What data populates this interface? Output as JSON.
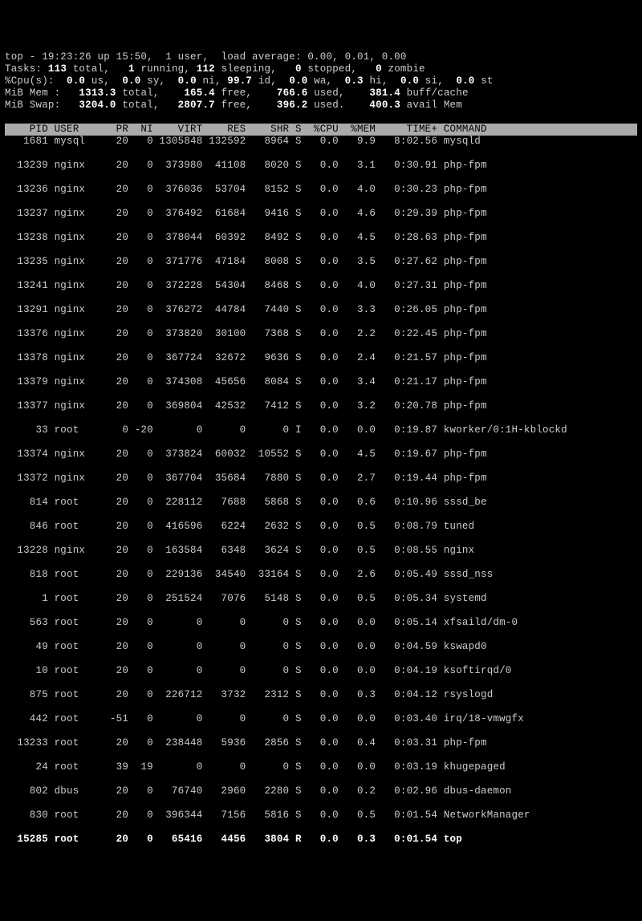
{
  "summary": {
    "line1_pre": "top - 19:23:26 up 15:50,  1 user,  load average: 0.00, 0.01, 0.00",
    "tasks": {
      "total": "113",
      "running": "1",
      "sleeping": "112",
      "stopped": "0",
      "zombie": "0"
    },
    "cpu": {
      "us": "0.0",
      "sy": "0.0",
      "ni": "0.0",
      "id": "99.7",
      "wa": "0.0",
      "hi": "0.3",
      "si": "0.0",
      "st": "0.0"
    },
    "mem": {
      "total": "1313.3",
      "free": "165.4",
      "used": "766.6",
      "buff": "381.4"
    },
    "swap": {
      "total": "3204.0",
      "free": "2807.7",
      "used": "396.2",
      "avail": "400.3"
    }
  },
  "columns": [
    "PID",
    "USER",
    "PR",
    "NI",
    "VIRT",
    "RES",
    "SHR",
    "S",
    "%CPU",
    "%MEM",
    "TIME+",
    "COMMAND"
  ],
  "processes": [
    {
      "pid": "1681",
      "user": "mysql",
      "pr": "20",
      "ni": "0",
      "virt": "1305848",
      "res": "132592",
      "shr": "8964",
      "s": "S",
      "cpu": "0.0",
      "mem": "9.9",
      "time": "8:02.56",
      "cmd": "mysqld"
    },
    {
      "pid": "13239",
      "user": "nginx",
      "pr": "20",
      "ni": "0",
      "virt": "373980",
      "res": "41108",
      "shr": "8020",
      "s": "S",
      "cpu": "0.0",
      "mem": "3.1",
      "time": "0:30.91",
      "cmd": "php-fpm"
    },
    {
      "pid": "13236",
      "user": "nginx",
      "pr": "20",
      "ni": "0",
      "virt": "376036",
      "res": "53704",
      "shr": "8152",
      "s": "S",
      "cpu": "0.0",
      "mem": "4.0",
      "time": "0:30.23",
      "cmd": "php-fpm"
    },
    {
      "pid": "13237",
      "user": "nginx",
      "pr": "20",
      "ni": "0",
      "virt": "376492",
      "res": "61684",
      "shr": "9416",
      "s": "S",
      "cpu": "0.0",
      "mem": "4.6",
      "time": "0:29.39",
      "cmd": "php-fpm"
    },
    {
      "pid": "13238",
      "user": "nginx",
      "pr": "20",
      "ni": "0",
      "virt": "378044",
      "res": "60392",
      "shr": "8492",
      "s": "S",
      "cpu": "0.0",
      "mem": "4.5",
      "time": "0:28.63",
      "cmd": "php-fpm"
    },
    {
      "pid": "13235",
      "user": "nginx",
      "pr": "20",
      "ni": "0",
      "virt": "371776",
      "res": "47184",
      "shr": "8008",
      "s": "S",
      "cpu": "0.0",
      "mem": "3.5",
      "time": "0:27.62",
      "cmd": "php-fpm"
    },
    {
      "pid": "13241",
      "user": "nginx",
      "pr": "20",
      "ni": "0",
      "virt": "372228",
      "res": "54304",
      "shr": "8468",
      "s": "S",
      "cpu": "0.0",
      "mem": "4.0",
      "time": "0:27.31",
      "cmd": "php-fpm"
    },
    {
      "pid": "13291",
      "user": "nginx",
      "pr": "20",
      "ni": "0",
      "virt": "376272",
      "res": "44784",
      "shr": "7440",
      "s": "S",
      "cpu": "0.0",
      "mem": "3.3",
      "time": "0:26.05",
      "cmd": "php-fpm"
    },
    {
      "pid": "13376",
      "user": "nginx",
      "pr": "20",
      "ni": "0",
      "virt": "373820",
      "res": "30100",
      "shr": "7368",
      "s": "S",
      "cpu": "0.0",
      "mem": "2.2",
      "time": "0:22.45",
      "cmd": "php-fpm"
    },
    {
      "pid": "13378",
      "user": "nginx",
      "pr": "20",
      "ni": "0",
      "virt": "367724",
      "res": "32672",
      "shr": "9636",
      "s": "S",
      "cpu": "0.0",
      "mem": "2.4",
      "time": "0:21.57",
      "cmd": "php-fpm"
    },
    {
      "pid": "13379",
      "user": "nginx",
      "pr": "20",
      "ni": "0",
      "virt": "374308",
      "res": "45656",
      "shr": "8084",
      "s": "S",
      "cpu": "0.0",
      "mem": "3.4",
      "time": "0:21.17",
      "cmd": "php-fpm"
    },
    {
      "pid": "13377",
      "user": "nginx",
      "pr": "20",
      "ni": "0",
      "virt": "369804",
      "res": "42532",
      "shr": "7412",
      "s": "S",
      "cpu": "0.0",
      "mem": "3.2",
      "time": "0:20.78",
      "cmd": "php-fpm"
    },
    {
      "pid": "33",
      "user": "root",
      "pr": "0",
      "ni": "-20",
      "virt": "0",
      "res": "0",
      "shr": "0",
      "s": "I",
      "cpu": "0.0",
      "mem": "0.0",
      "time": "0:19.87",
      "cmd": "kworker/0:1H-kblockd"
    },
    {
      "pid": "13374",
      "user": "nginx",
      "pr": "20",
      "ni": "0",
      "virt": "373824",
      "res": "60032",
      "shr": "10552",
      "s": "S",
      "cpu": "0.0",
      "mem": "4.5",
      "time": "0:19.67",
      "cmd": "php-fpm"
    },
    {
      "pid": "13372",
      "user": "nginx",
      "pr": "20",
      "ni": "0",
      "virt": "367704",
      "res": "35684",
      "shr": "7880",
      "s": "S",
      "cpu": "0.0",
      "mem": "2.7",
      "time": "0:19.44",
      "cmd": "php-fpm"
    },
    {
      "pid": "814",
      "user": "root",
      "pr": "20",
      "ni": "0",
      "virt": "228112",
      "res": "7688",
      "shr": "5868",
      "s": "S",
      "cpu": "0.0",
      "mem": "0.6",
      "time": "0:10.96",
      "cmd": "sssd_be"
    },
    {
      "pid": "846",
      "user": "root",
      "pr": "20",
      "ni": "0",
      "virt": "416596",
      "res": "6224",
      "shr": "2632",
      "s": "S",
      "cpu": "0.0",
      "mem": "0.5",
      "time": "0:08.79",
      "cmd": "tuned"
    },
    {
      "pid": "13228",
      "user": "nginx",
      "pr": "20",
      "ni": "0",
      "virt": "163584",
      "res": "6348",
      "shr": "3624",
      "s": "S",
      "cpu": "0.0",
      "mem": "0.5",
      "time": "0:08.55",
      "cmd": "nginx"
    },
    {
      "pid": "818",
      "user": "root",
      "pr": "20",
      "ni": "0",
      "virt": "229136",
      "res": "34540",
      "shr": "33164",
      "s": "S",
      "cpu": "0.0",
      "mem": "2.6",
      "time": "0:05.49",
      "cmd": "sssd_nss"
    },
    {
      "pid": "1",
      "user": "root",
      "pr": "20",
      "ni": "0",
      "virt": "251524",
      "res": "7076",
      "shr": "5148",
      "s": "S",
      "cpu": "0.0",
      "mem": "0.5",
      "time": "0:05.34",
      "cmd": "systemd"
    },
    {
      "pid": "563",
      "user": "root",
      "pr": "20",
      "ni": "0",
      "virt": "0",
      "res": "0",
      "shr": "0",
      "s": "S",
      "cpu": "0.0",
      "mem": "0.0",
      "time": "0:05.14",
      "cmd": "xfsaild/dm-0"
    },
    {
      "pid": "49",
      "user": "root",
      "pr": "20",
      "ni": "0",
      "virt": "0",
      "res": "0",
      "shr": "0",
      "s": "S",
      "cpu": "0.0",
      "mem": "0.0",
      "time": "0:04.59",
      "cmd": "kswapd0"
    },
    {
      "pid": "10",
      "user": "root",
      "pr": "20",
      "ni": "0",
      "virt": "0",
      "res": "0",
      "shr": "0",
      "s": "S",
      "cpu": "0.0",
      "mem": "0.0",
      "time": "0:04.19",
      "cmd": "ksoftirqd/0"
    },
    {
      "pid": "875",
      "user": "root",
      "pr": "20",
      "ni": "0",
      "virt": "226712",
      "res": "3732",
      "shr": "2312",
      "s": "S",
      "cpu": "0.0",
      "mem": "0.3",
      "time": "0:04.12",
      "cmd": "rsyslogd"
    },
    {
      "pid": "442",
      "user": "root",
      "pr": "-51",
      "ni": "0",
      "virt": "0",
      "res": "0",
      "shr": "0",
      "s": "S",
      "cpu": "0.0",
      "mem": "0.0",
      "time": "0:03.40",
      "cmd": "irq/18-vmwgfx"
    },
    {
      "pid": "13233",
      "user": "root",
      "pr": "20",
      "ni": "0",
      "virt": "238448",
      "res": "5936",
      "shr": "2856",
      "s": "S",
      "cpu": "0.0",
      "mem": "0.4",
      "time": "0:03.31",
      "cmd": "php-fpm"
    },
    {
      "pid": "24",
      "user": "root",
      "pr": "39",
      "ni": "19",
      "virt": "0",
      "res": "0",
      "shr": "0",
      "s": "S",
      "cpu": "0.0",
      "mem": "0.0",
      "time": "0:03.19",
      "cmd": "khugepaged"
    },
    {
      "pid": "802",
      "user": "dbus",
      "pr": "20",
      "ni": "0",
      "virt": "76740",
      "res": "2960",
      "shr": "2280",
      "s": "S",
      "cpu": "0.0",
      "mem": "0.2",
      "time": "0:02.96",
      "cmd": "dbus-daemon"
    },
    {
      "pid": "830",
      "user": "root",
      "pr": "20",
      "ni": "0",
      "virt": "396344",
      "res": "7156",
      "shr": "5816",
      "s": "S",
      "cpu": "0.0",
      "mem": "0.5",
      "time": "0:01.54",
      "cmd": "NetworkManager"
    },
    {
      "pid": "15285",
      "user": "root",
      "pr": "20",
      "ni": "0",
      "virt": "65416",
      "res": "4456",
      "shr": "3804",
      "s": "R",
      "cpu": "0.0",
      "mem": "0.3",
      "time": "0:01.54",
      "cmd": "top",
      "current": true
    }
  ]
}
